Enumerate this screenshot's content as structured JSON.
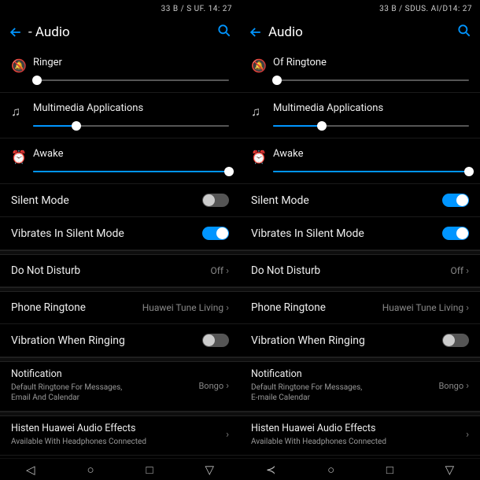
{
  "left": {
    "status": "33 B / S UF. 14: 27",
    "title": "- Audio",
    "sliders": [
      {
        "icon": "🔕",
        "label": "Ringer",
        "pct": 2
      },
      {
        "icon": "♫",
        "label": "Multimedia Applications",
        "pct": 22
      },
      {
        "icon": "⏰",
        "label": "Awake",
        "pct": 100
      }
    ],
    "silent": {
      "label": "Silent Mode",
      "on": false,
      "accent": false
    },
    "vibsilent": {
      "label": "Vibrates In Silent Mode",
      "on": true
    },
    "dnd": {
      "label": "Do Not Disturb",
      "val": "Off"
    },
    "ringtone": {
      "label": "Phone Ringtone",
      "val": "Huawei Tune Living"
    },
    "vibring": {
      "label": "Vibration When Ringing",
      "on": false
    },
    "notif": {
      "label": "Notification",
      "sub": "Default Ringtone For Messages,\nEmail And Calendar",
      "val": "Bongo"
    },
    "huawei": {
      "label": "Histen Huawei Audio Effects",
      "sub": "Available With Headphones Connected"
    },
    "nav": [
      "◁",
      "○",
      "□",
      "▽"
    ]
  },
  "right": {
    "status": "33 B / SDUS. AI/D14: 27",
    "title": "Audio",
    "sliders": [
      {
        "icon": "🔕",
        "label": "Of Ringtone",
        "pct": 2
      },
      {
        "icon": "♫",
        "label": "Multimedia Applications",
        "pct": 25
      },
      {
        "icon": "⏰",
        "label": "Awake",
        "pct": 100
      }
    ],
    "silent": {
      "label": "Silent Mode",
      "on": true,
      "accent": true
    },
    "vibsilent": {
      "label": "Vibrates In Silent Mode",
      "on": true
    },
    "dnd": {
      "label": "Do Not Disturb",
      "val": "Off"
    },
    "ringtone": {
      "label": "Phone Ringtone",
      "val": "Huawei Tune Living"
    },
    "vibring": {
      "label": "Vibration When Ringing",
      "on": false
    },
    "notif": {
      "label": "Notification",
      "sub": "Default Ringtone For Messages,\nE-maile Calendar",
      "val": "Bongo"
    },
    "huawei": {
      "label": "Histen Huawei Audio Effects",
      "sub": "Available With Headphones Connected"
    },
    "nav": [
      "≺",
      "○",
      "□",
      "▽"
    ]
  }
}
